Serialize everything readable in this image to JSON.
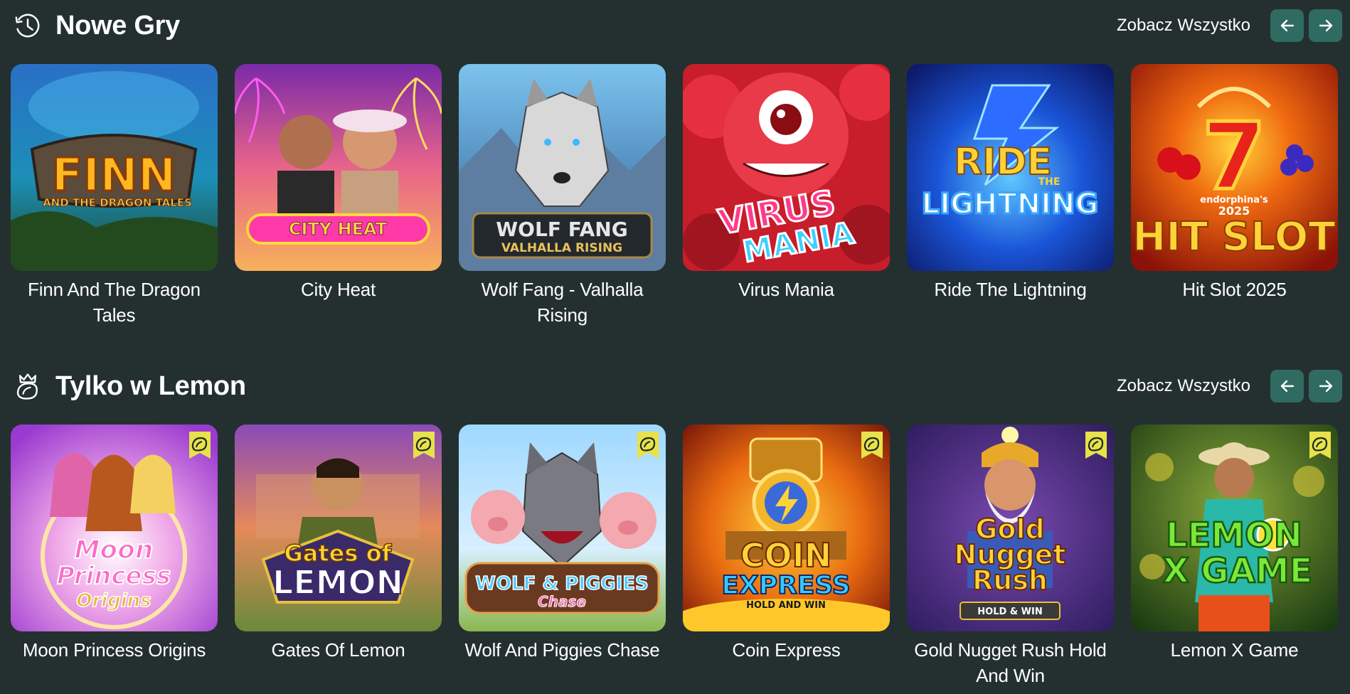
{
  "sections": [
    {
      "title": "Nowe Gry",
      "icon": "clock-icon",
      "see_all": "Zobacz Wszystko",
      "games": [
        {
          "name": "Finn And The Dragon Tales",
          "art_main": "FINN",
          "art_sub": "AND THE DRAGON TALES"
        },
        {
          "name": "City Heat",
          "art_main": "CITY HEAT"
        },
        {
          "name": "Wolf Fang - Valhalla Rising",
          "art_main": "WOLF FANG",
          "art_sub": "VALHALLA RISING"
        },
        {
          "name": "Virus Mania",
          "art_main": "VIRUS",
          "art_sub": "MANIA"
        },
        {
          "name": "Ride The Lightning",
          "art_main": "RIDE",
          "art_mid": "THE",
          "art_sub": "LIGHTNING"
        },
        {
          "name": "Hit Slot 2025",
          "art_top": "endorphina's",
          "art_year": "2025",
          "art_main": "HIT SLOT"
        }
      ]
    },
    {
      "title": "Tylko w Lemon",
      "icon": "lemon-crown-icon",
      "see_all": "Zobacz Wszystko",
      "games": [
        {
          "name": "Moon Princess Origins",
          "art_main": "Moon",
          "art_mid": "Princess",
          "art_sub": "Origins"
        },
        {
          "name": "Gates Of Lemon",
          "art_main": "Gates of",
          "art_sub": "LEMON"
        },
        {
          "name": "Wolf And Piggies Chase",
          "art_main": "WOLF & PIGGIES",
          "art_sub": "Chase"
        },
        {
          "name": "Coin Express",
          "art_main": "COIN",
          "art_mid": "EXPRESS",
          "art_sub": "HOLD AND WIN"
        },
        {
          "name": "Gold Nugget Rush Hold And Win",
          "art_main": "Gold",
          "art_mid": "Nugget",
          "art_sub": "Rush",
          "art_tag": "HOLD & WIN"
        },
        {
          "name": "Lemon X Game",
          "art_main": "LEMON",
          "art_sub": "X GAME"
        }
      ]
    }
  ],
  "colors": {
    "background": "#243030",
    "nav_button": "#2f6b61",
    "exclusive_badge": "#e8e14a"
  }
}
